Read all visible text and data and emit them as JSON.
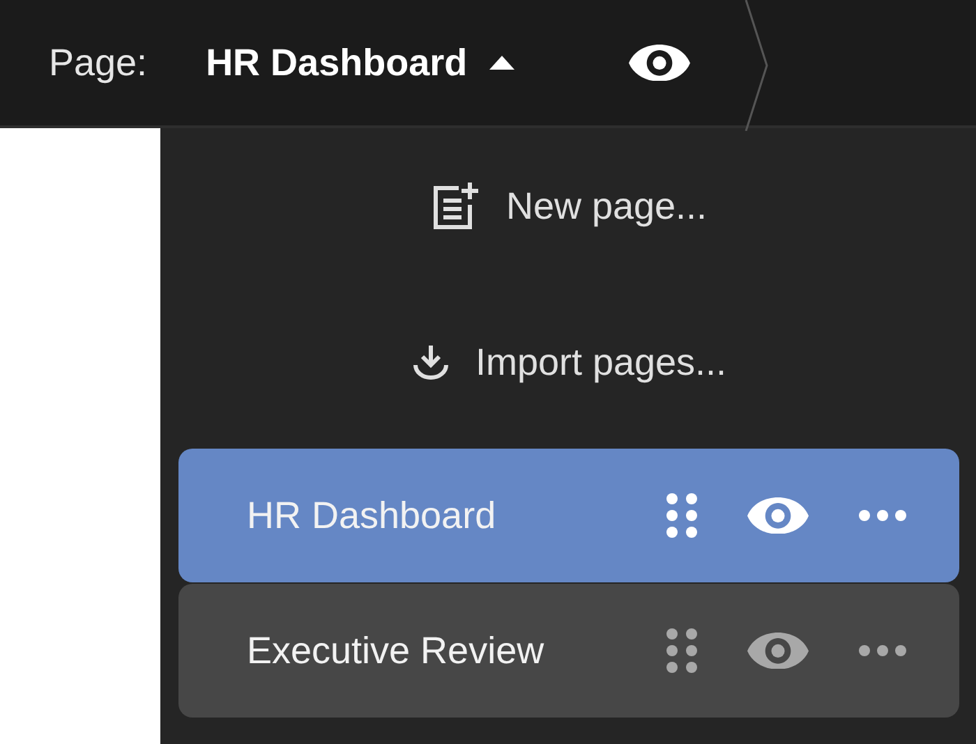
{
  "toolbar": {
    "label": "Page:",
    "current_page": "HR Dashboard",
    "menu_open": true
  },
  "menu": {
    "actions": [
      {
        "kind": "new",
        "label": "New page..."
      },
      {
        "kind": "import",
        "label": "Import pages..."
      }
    ],
    "pages": [
      {
        "name": "HR Dashboard",
        "selected": true
      },
      {
        "name": "Executive Review",
        "selected": false
      }
    ]
  }
}
